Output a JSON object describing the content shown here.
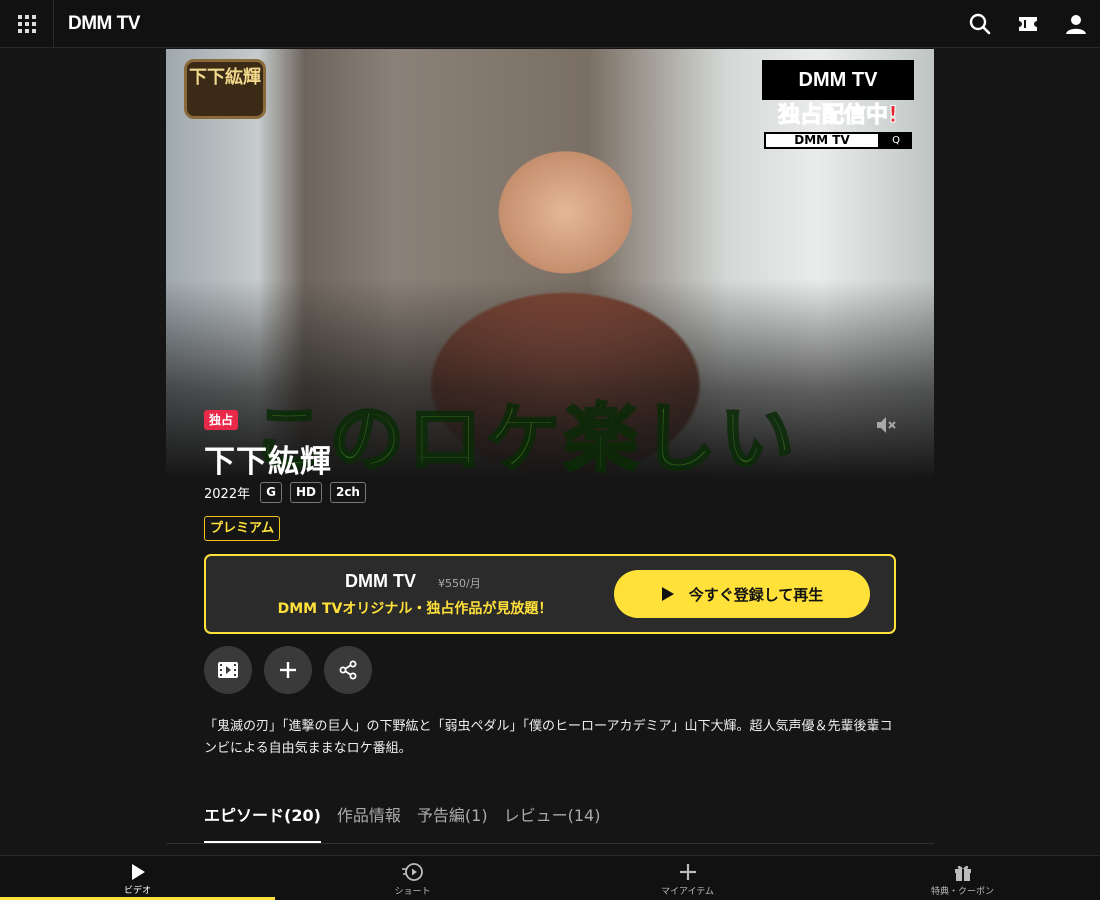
{
  "header": {
    "logo": "DMM TV",
    "icons": [
      "grid-menu-icon",
      "search-icon",
      "ticket-icon",
      "user-icon"
    ]
  },
  "hero": {
    "show_logo": "下下紘輝",
    "caption": "このロケ楽しい",
    "badge_logo": "DMM TV",
    "badge_text": "独占配信中!",
    "badge_search_text": "DMM TV",
    "badge_search_btn": "Q"
  },
  "title_block": {
    "exclusive_tag": "独占",
    "title": "下下紘輝",
    "year": "2022年",
    "chips": [
      "G",
      "HD",
      "2ch"
    ],
    "premium_tag": "プレミアム"
  },
  "subscribe": {
    "logo": "DMM TV",
    "price": "¥550/月",
    "description": "DMM TVオリジナル・独占作品が見放題！",
    "play_label": "今すぐ登録して再生"
  },
  "actions": [
    "film-icon",
    "plus-icon",
    "share-icon"
  ],
  "description": "「鬼滅の刃」「進撃の巨人」の下野紘と「弱虫ペダル」「僕のヒーローアカデミア」山下大輝。超人気声優＆先輩後輩コンビによる自由気ままなロケ番組。",
  "tabs": [
    {
      "label": "エピソード(20)",
      "active": true
    },
    {
      "label": "作品情報"
    },
    {
      "label": "予告編(1)"
    },
    {
      "label": "レビュー(14)"
    }
  ],
  "bottom_nav": [
    {
      "label": "ビデオ",
      "icon": "play-icon",
      "active": true
    },
    {
      "label": "ショート",
      "icon": "short-icon"
    },
    {
      "label": "マイアイテム",
      "icon": "plus-icon"
    },
    {
      "label": "特典・クーポン",
      "icon": "gift-icon"
    }
  ],
  "colors": {
    "accent_yellow": "#ffe13a",
    "exclusive_red": "#e8294a",
    "background": "#151515"
  }
}
